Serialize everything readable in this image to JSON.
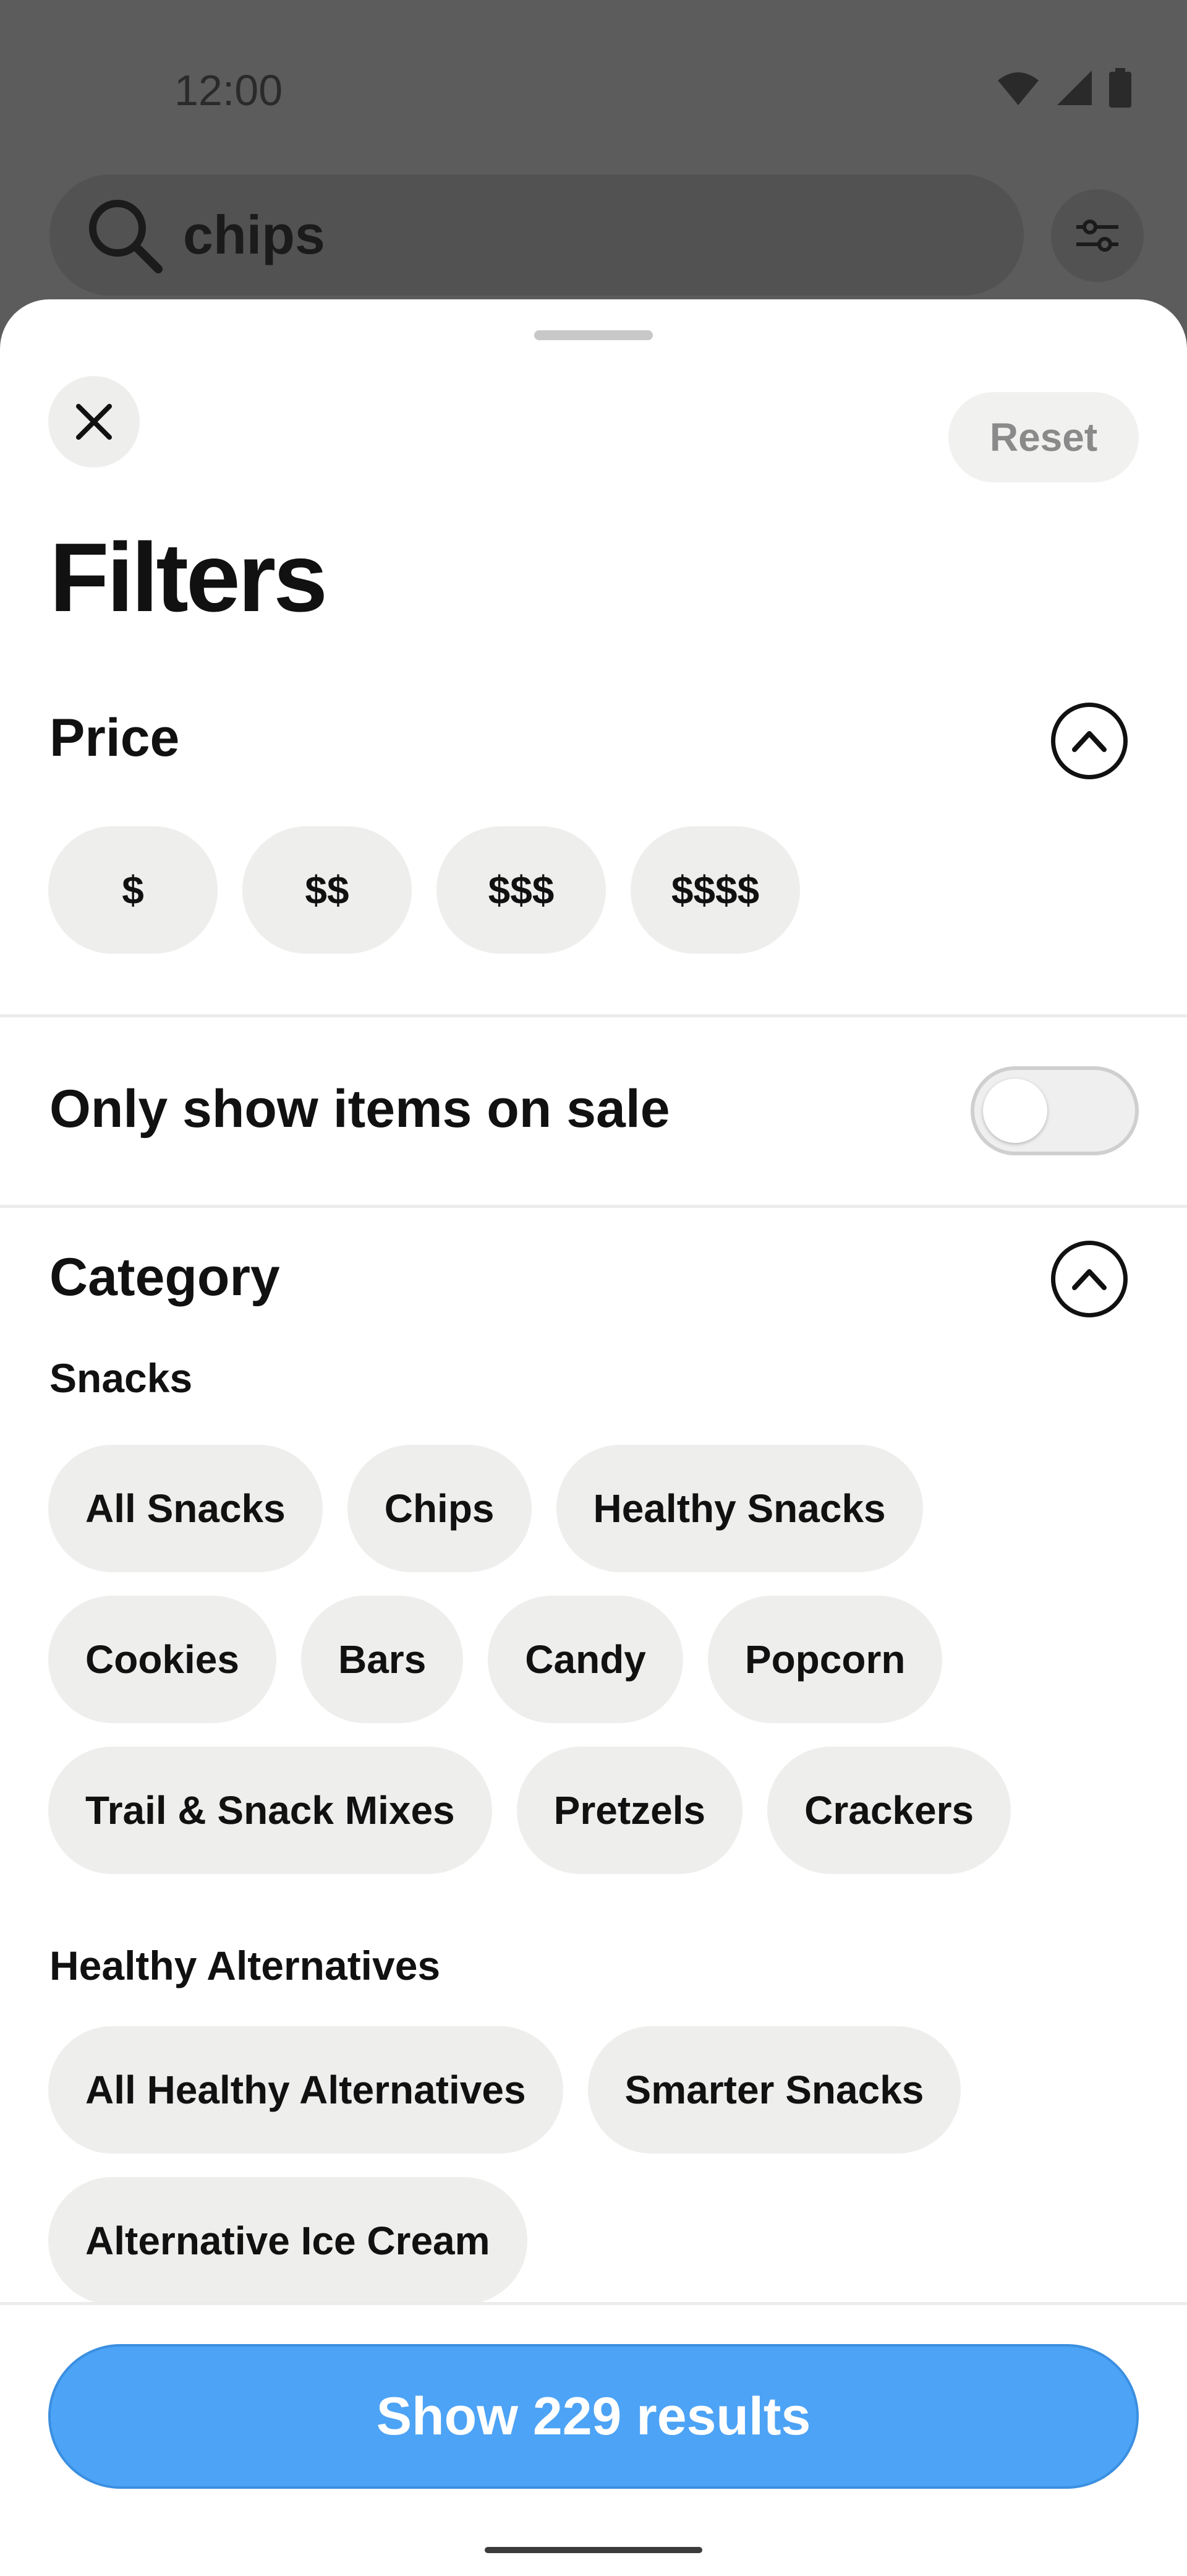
{
  "status_bar": {
    "time": "12:00",
    "icons": [
      "wifi-icon",
      "signal-icon",
      "battery-icon"
    ]
  },
  "search": {
    "value": "chips",
    "icon": "search-icon"
  },
  "filter_button_icon": "sliders-icon",
  "sheet": {
    "close_icon": "close-icon",
    "reset_label": "Reset",
    "title": "Filters"
  },
  "price": {
    "title": "Price",
    "options": [
      "$",
      "$$",
      "$$$",
      "$$$$"
    ]
  },
  "sale": {
    "label": "Only show items on sale",
    "enabled": false
  },
  "category": {
    "title": "Category",
    "groups": [
      {
        "name": "Snacks",
        "rows": [
          [
            "All Snacks",
            "Chips",
            "Healthy Snacks"
          ],
          [
            "Cookies",
            "Bars",
            "Candy",
            "Popcorn"
          ],
          [
            "Trail & Snack Mixes",
            "Pretzels",
            "Crackers"
          ]
        ]
      },
      {
        "name": "Healthy Alternatives",
        "rows": [
          [
            "All Healthy Alternatives",
            "Smarter Snacks"
          ],
          [
            "Alternative Ice Cream"
          ]
        ]
      }
    ]
  },
  "footer": {
    "button_label": "Show 229 results"
  },
  "colors": {
    "accent": "#4da3f5",
    "chip_bg": "#eeefed",
    "overlay": "#5c5c5c"
  }
}
